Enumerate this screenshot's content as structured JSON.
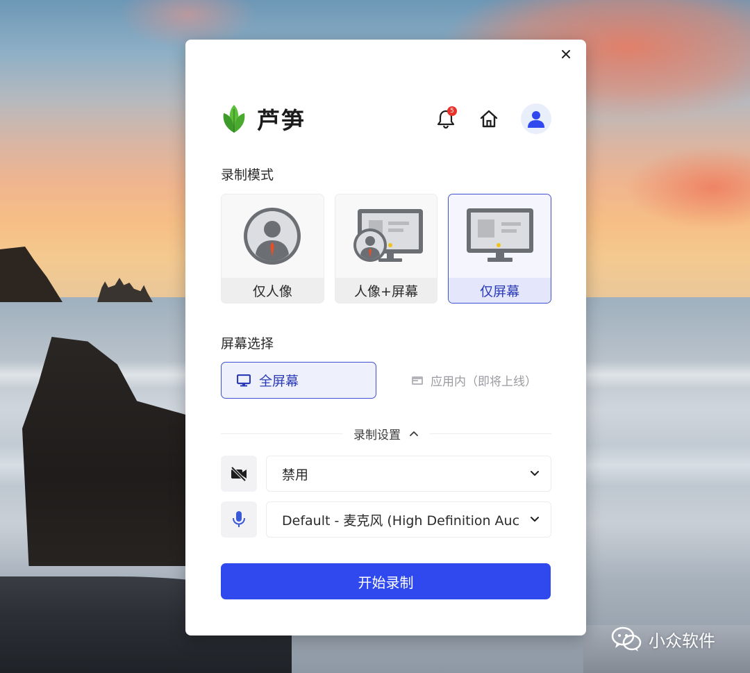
{
  "app": {
    "name": "芦笋",
    "close_icon": "close-icon"
  },
  "header": {
    "notification_badge": "5",
    "icons": [
      "bell-icon",
      "home-icon",
      "user-icon"
    ]
  },
  "recording_mode": {
    "title": "录制模式",
    "options": [
      {
        "label": "仅人像",
        "icon": "person-avatar-icon",
        "selected": false
      },
      {
        "label": "人像+屏幕",
        "icon": "person-screen-icon",
        "selected": false
      },
      {
        "label": "仅屏幕",
        "icon": "monitor-icon",
        "selected": true
      }
    ]
  },
  "screen_selection": {
    "title": "屏幕选择",
    "full_screen": {
      "label": "全屏幕",
      "icon": "monitor-small-icon",
      "selected": true
    },
    "in_app": {
      "label": "应用内（即将上线）",
      "icon": "window-icon",
      "enabled": false
    }
  },
  "recording_settings": {
    "title": "录制设置",
    "expanded": true,
    "camera": {
      "icon": "camera-off-icon",
      "value": "禁用"
    },
    "microphone": {
      "icon": "microphone-icon",
      "value": "Default - 麦克风 (High Definition Auc"
    }
  },
  "start_button": {
    "label": "开始录制"
  },
  "watermark": {
    "text": "小众软件"
  },
  "colors": {
    "accent": "#2f49ef",
    "selected_border": "#3c4fd0",
    "selected_bg": "#eef0fc",
    "badge": "#e8332b"
  }
}
